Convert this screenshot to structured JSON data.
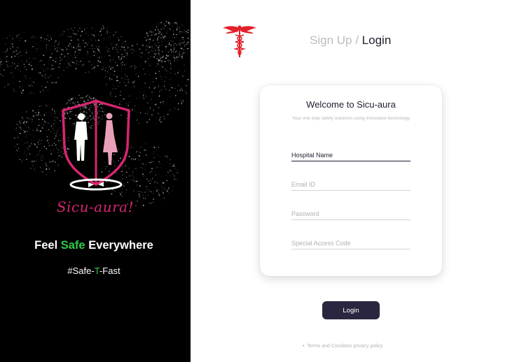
{
  "brand": {
    "script_name": "Sicu-aura!",
    "tagline_pre": "Feel ",
    "tagline_highlight": "Safe",
    "tagline_post": " Everywhere",
    "hashtag_pre": "#Safe-",
    "hashtag_highlight": "T",
    "hashtag_post": "-Fast",
    "accent_color": "#d6266f",
    "highlight_color": "#2ecc4a"
  },
  "auth_tabs": {
    "signup_label": "Sign Up /",
    "login_label": "Login"
  },
  "card": {
    "title": "Welcome to Sicu-aura",
    "subtitle": "Your one stop safety solutions using innovative technology"
  },
  "form": {
    "hospital_name": {
      "value": "Hospital Name",
      "placeholder": "Hospital Name"
    },
    "email": {
      "value": "",
      "placeholder": "Email ID"
    },
    "password": {
      "value": "",
      "placeholder": "Password"
    },
    "access_code": {
      "value": "",
      "placeholder": "Special Access Code"
    },
    "submit_label": "Login"
  },
  "footer": {
    "bullet": "•",
    "terms_label": "Terms and Condition",
    "privacy_label": "privacy policy"
  },
  "icons": {
    "caduceus": "caduceus-icon",
    "shield": "shield-logo-icon"
  },
  "colors": {
    "button": "#2b2640",
    "caduceus": "#e3202a"
  }
}
